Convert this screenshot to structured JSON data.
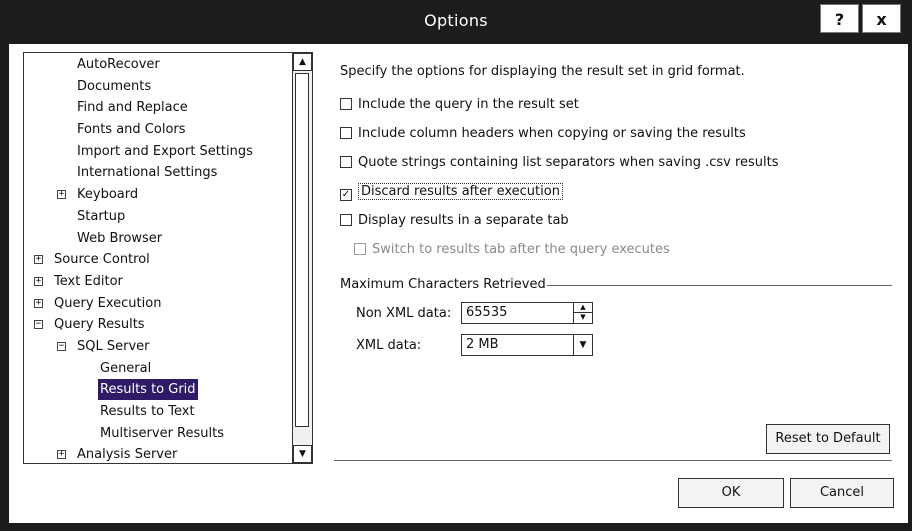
{
  "window": {
    "title": "Options",
    "help_label": "?",
    "close_label": "x"
  },
  "tree": {
    "items": [
      {
        "label": "AutoRecover",
        "indent": 1,
        "expander": ""
      },
      {
        "label": "Documents",
        "indent": 1,
        "expander": ""
      },
      {
        "label": "Find and Replace",
        "indent": 1,
        "expander": ""
      },
      {
        "label": "Fonts and Colors",
        "indent": 1,
        "expander": ""
      },
      {
        "label": "Import and Export Settings",
        "indent": 1,
        "expander": ""
      },
      {
        "label": "International Settings",
        "indent": 1,
        "expander": ""
      },
      {
        "label": "Keyboard",
        "indent": 1,
        "expander": "+"
      },
      {
        "label": "Startup",
        "indent": 1,
        "expander": ""
      },
      {
        "label": "Web Browser",
        "indent": 1,
        "expander": ""
      },
      {
        "label": "Source Control",
        "indent": 0,
        "expander": "+"
      },
      {
        "label": "Text Editor",
        "indent": 0,
        "expander": "+"
      },
      {
        "label": "Query Execution",
        "indent": 0,
        "expander": "+"
      },
      {
        "label": "Query Results",
        "indent": 0,
        "expander": "−"
      },
      {
        "label": "SQL Server",
        "indent": 1,
        "expander": "−"
      },
      {
        "label": "General",
        "indent": 2,
        "expander": ""
      },
      {
        "label": "Results to Grid",
        "indent": 2,
        "expander": "",
        "selected": true
      },
      {
        "label": "Results to Text",
        "indent": 2,
        "expander": ""
      },
      {
        "label": "Multiserver Results",
        "indent": 2,
        "expander": ""
      },
      {
        "label": "Analysis Server",
        "indent": 1,
        "expander": "+"
      }
    ],
    "scroll_up": "▲",
    "scroll_down": "▼"
  },
  "pane": {
    "description": "Specify the options for displaying the result set in grid format.",
    "options": [
      {
        "label": "Include the query in the result set",
        "checked": false,
        "enabled": true
      },
      {
        "label": "Include column headers when copying or saving the results",
        "checked": false,
        "enabled": true
      },
      {
        "label": "Quote strings containing list separators when saving .csv results",
        "checked": false,
        "enabled": true
      },
      {
        "label": "Discard results after execution",
        "checked": true,
        "enabled": true
      },
      {
        "label": "Display results in a separate tab",
        "checked": false,
        "enabled": true
      },
      {
        "label": "Switch to results tab after the query executes",
        "checked": false,
        "enabled": false
      }
    ],
    "max_chars_group": "Maximum Characters Retrieved",
    "non_xml_label": "Non XML data:",
    "non_xml_value": "65535",
    "xml_label": "XML data:",
    "xml_value": "2 MB",
    "reset_button": "Reset to Default"
  },
  "footer": {
    "ok_label": "OK",
    "cancel_label": "Cancel"
  }
}
